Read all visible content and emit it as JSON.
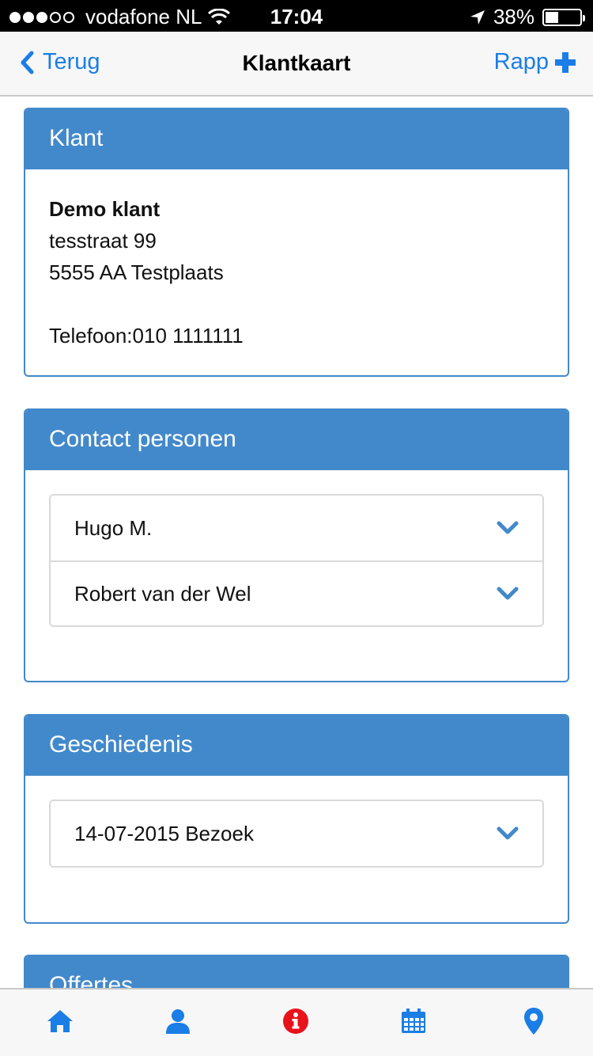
{
  "status_bar": {
    "carrier": "vodafone NL",
    "time": "17:04",
    "battery": "38%",
    "battery_level": 0.38,
    "signal_bars_filled": 3,
    "signal_bars_total": 5
  },
  "nav": {
    "back_label": "Terug",
    "title": "Klantkaart",
    "action_label": "Rapp"
  },
  "customer_panel": {
    "title": "Klant",
    "name": "Demo klant",
    "street": "tesstraat 99",
    "postal_city": "5555 AA Testplaats",
    "phone": "Telefoon:010 1111111"
  },
  "contacts_panel": {
    "title": "Contact personen",
    "items": [
      {
        "label": "Hugo M."
      },
      {
        "label": "Robert van der Wel"
      }
    ]
  },
  "history_panel": {
    "title": "Geschiedenis",
    "items": [
      {
        "label": "14-07-2015 Bezoek"
      }
    ]
  },
  "quotes_panel": {
    "title": "Offertes"
  },
  "tab_bar": {
    "tabs": [
      {
        "icon": "home-icon"
      },
      {
        "icon": "user-icon"
      },
      {
        "icon": "info-icon"
      },
      {
        "icon": "calendar-icon"
      },
      {
        "icon": "location-pin-icon"
      }
    ]
  },
  "colors": {
    "accent": "#1a7ee6",
    "panel_header": "#4289cb",
    "info_badge": "#e8121b"
  }
}
